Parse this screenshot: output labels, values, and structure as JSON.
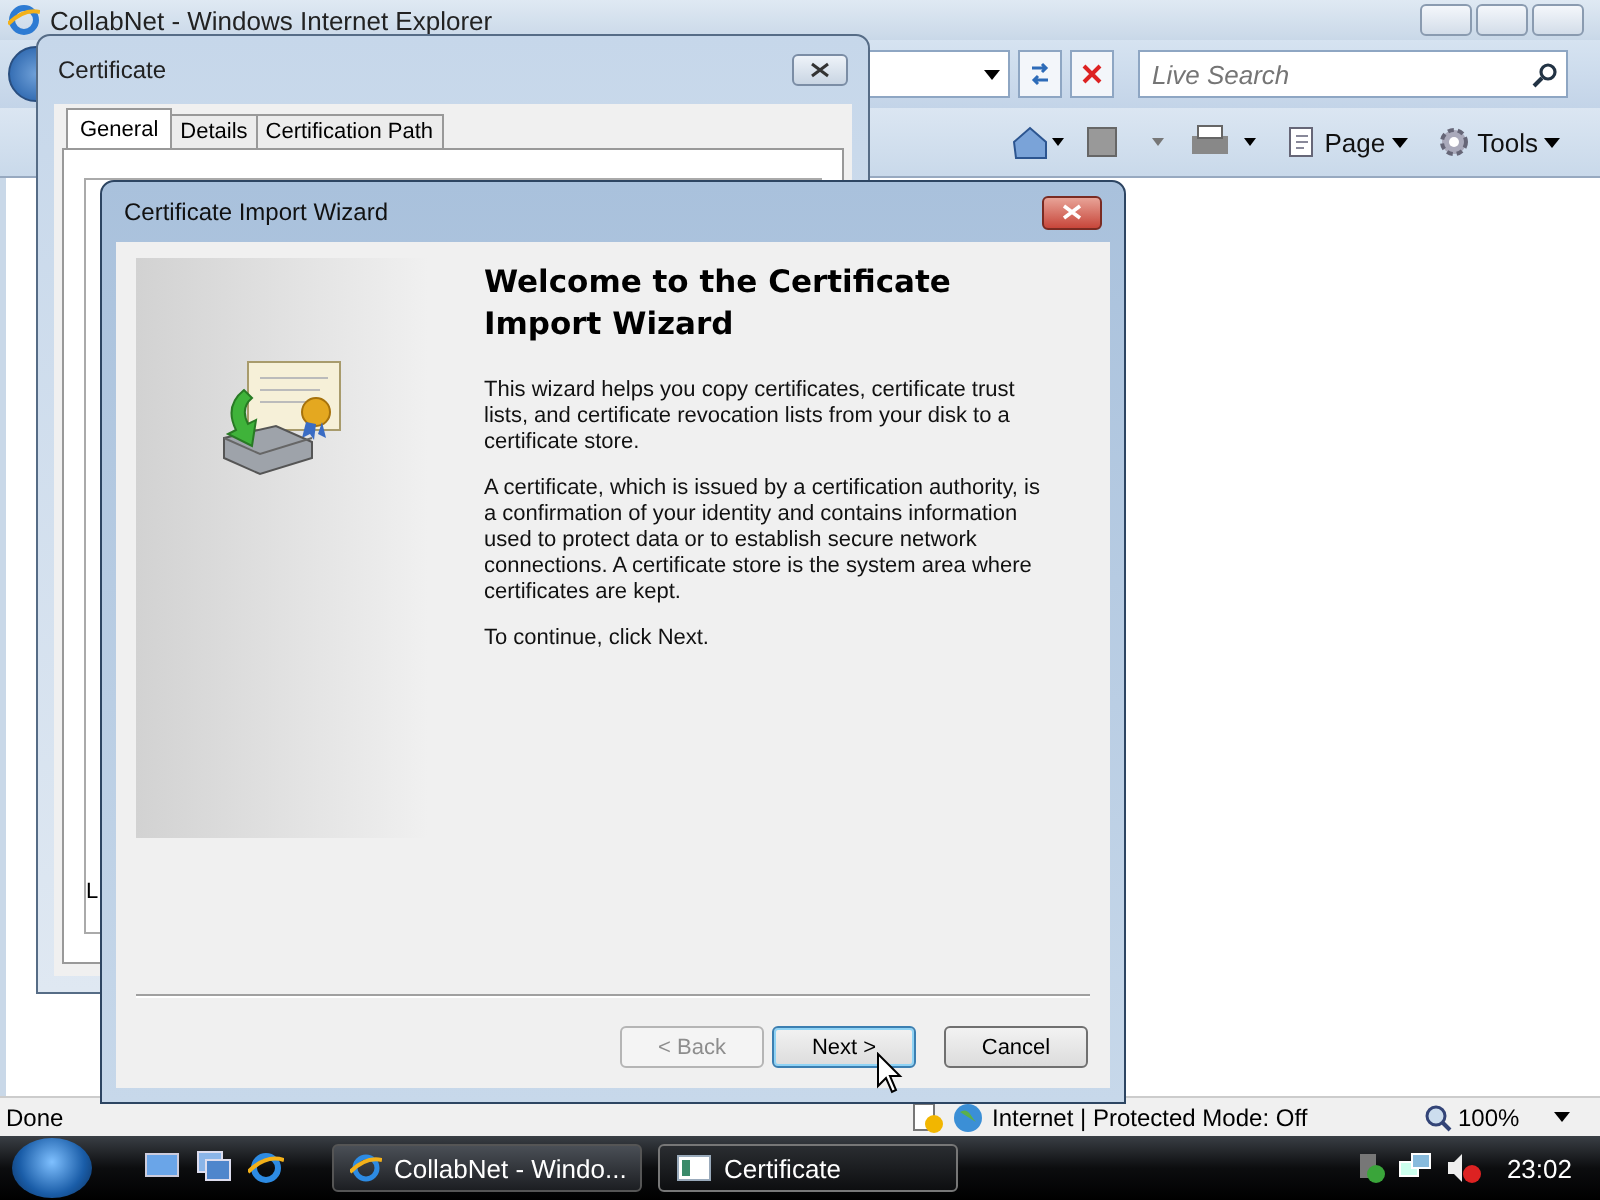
{
  "browser": {
    "title": "CollabNet - Windows Internet Explorer",
    "search": {
      "placeholder": "Live Search"
    },
    "toolbar": [
      {
        "label": "Page"
      },
      {
        "label": "Tools"
      }
    ],
    "status_bar": {
      "text": "Done",
      "zone": "Internet | Protected Mode: Off",
      "zoom": "100%"
    }
  },
  "certificate_dialog": {
    "title": "Certificate",
    "tabs": [
      {
        "label": "General",
        "selected": true
      },
      {
        "label": "Details",
        "selected": false
      },
      {
        "label": "Certification Path",
        "selected": false
      }
    ],
    "text_fragment": "L"
  },
  "wizard": {
    "title": "Certificate Import Wizard",
    "heading": "Welcome to the Certificate Import Wizard",
    "paragraphs": [
      "This wizard helps you copy certificates, certificate trust lists, and certificate revocation lists from your disk to a certificate store.",
      "A certificate, which is issued by a certification authority, is a confirmation of your identity and contains information used to protect data or to establish secure network connections. A certificate store is the system area where certificates are kept.",
      "To continue, click Next."
    ],
    "buttons": [
      {
        "label": "< Back",
        "disabled": true
      },
      {
        "label": "Next >",
        "disabled": false
      },
      {
        "label": "Cancel",
        "disabled": false
      }
    ]
  },
  "taskbar": {
    "items": [
      {
        "label": "CollabNet - Windo...",
        "selected": false
      },
      {
        "label": "Certificate",
        "selected": true
      }
    ],
    "clock": "23:02"
  }
}
